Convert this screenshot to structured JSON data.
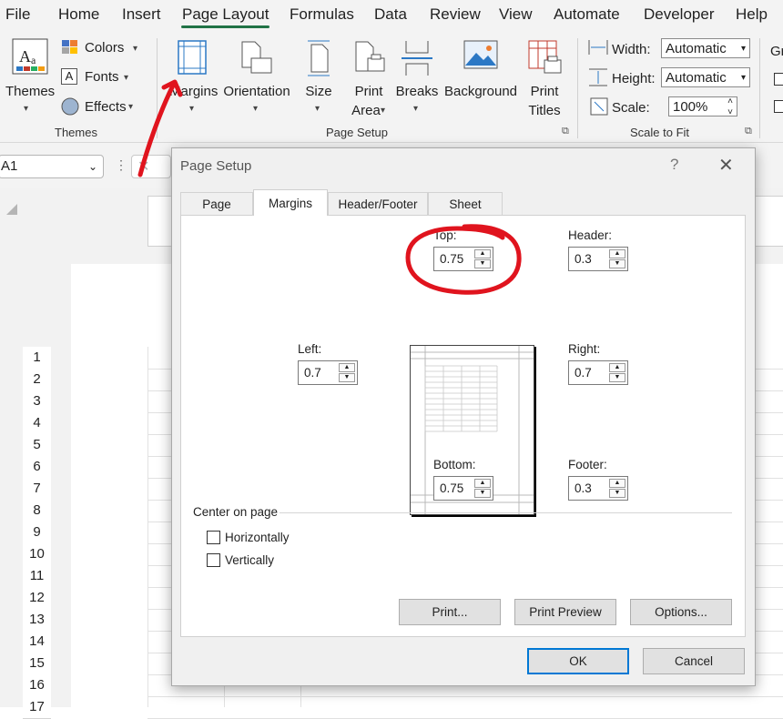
{
  "menu": {
    "tabs": [
      "File",
      "Home",
      "Insert",
      "Page Layout",
      "Formulas",
      "Data",
      "Review",
      "View",
      "Automate",
      "Developer",
      "Help"
    ],
    "active": "Page Layout"
  },
  "ribbon": {
    "themes": {
      "themes_label": "Themes",
      "colors_label": "Colors",
      "fonts_label": "Fonts",
      "effects_label": "Effects",
      "group_label": "Themes"
    },
    "page_setup": {
      "margins_label": "Margins",
      "orientation_label": "Orientation",
      "size_label": "Size",
      "print_area_label_1": "Print",
      "print_area_label_2": "Area",
      "breaks_label": "Breaks",
      "background_label": "Background",
      "print_titles_label_1": "Print",
      "print_titles_label_2": "Titles",
      "group_label": "Page Setup"
    },
    "scale_to_fit": {
      "width_label": "Width:",
      "width_value": "Automatic",
      "height_label": "Height:",
      "height_value": "Automatic",
      "scale_label": "Scale:",
      "scale_value": "100%",
      "group_label": "Scale to Fit"
    },
    "sheet_options": {
      "partial_label": "Gr"
    }
  },
  "formula_bar": {
    "name_box": "A1"
  },
  "sheet": {
    "row_numbers": [
      "1",
      "2",
      "3",
      "4",
      "5",
      "6",
      "7",
      "8",
      "9",
      "10",
      "11",
      "12",
      "13",
      "14",
      "15",
      "16",
      "17"
    ]
  },
  "dialog": {
    "title": "Page Setup",
    "help": "?",
    "tabs": [
      "Page",
      "Margins",
      "Header/Footer",
      "Sheet"
    ],
    "active_tab": "Margins",
    "top": {
      "label": "Top:",
      "value": "0.75"
    },
    "header": {
      "label": "Header:",
      "value": "0.3"
    },
    "left": {
      "label": "Left:",
      "value": "0.7"
    },
    "right": {
      "label": "Right:",
      "value": "0.7"
    },
    "bottom": {
      "label": "Bottom:",
      "value": "0.75"
    },
    "footer": {
      "label": "Footer:",
      "value": "0.3"
    },
    "center_on_page": {
      "label": "Center on page",
      "horizontally": "Horizontally",
      "vertically": "Vertically"
    },
    "buttons": {
      "print": "Print...",
      "print_preview": "Print Preview",
      "options": "Options...",
      "ok": "OK",
      "cancel": "Cancel"
    }
  },
  "colors": {
    "accent_green": "#217346",
    "annotation_red": "#e0141e",
    "focus_blue": "#0078d4"
  }
}
